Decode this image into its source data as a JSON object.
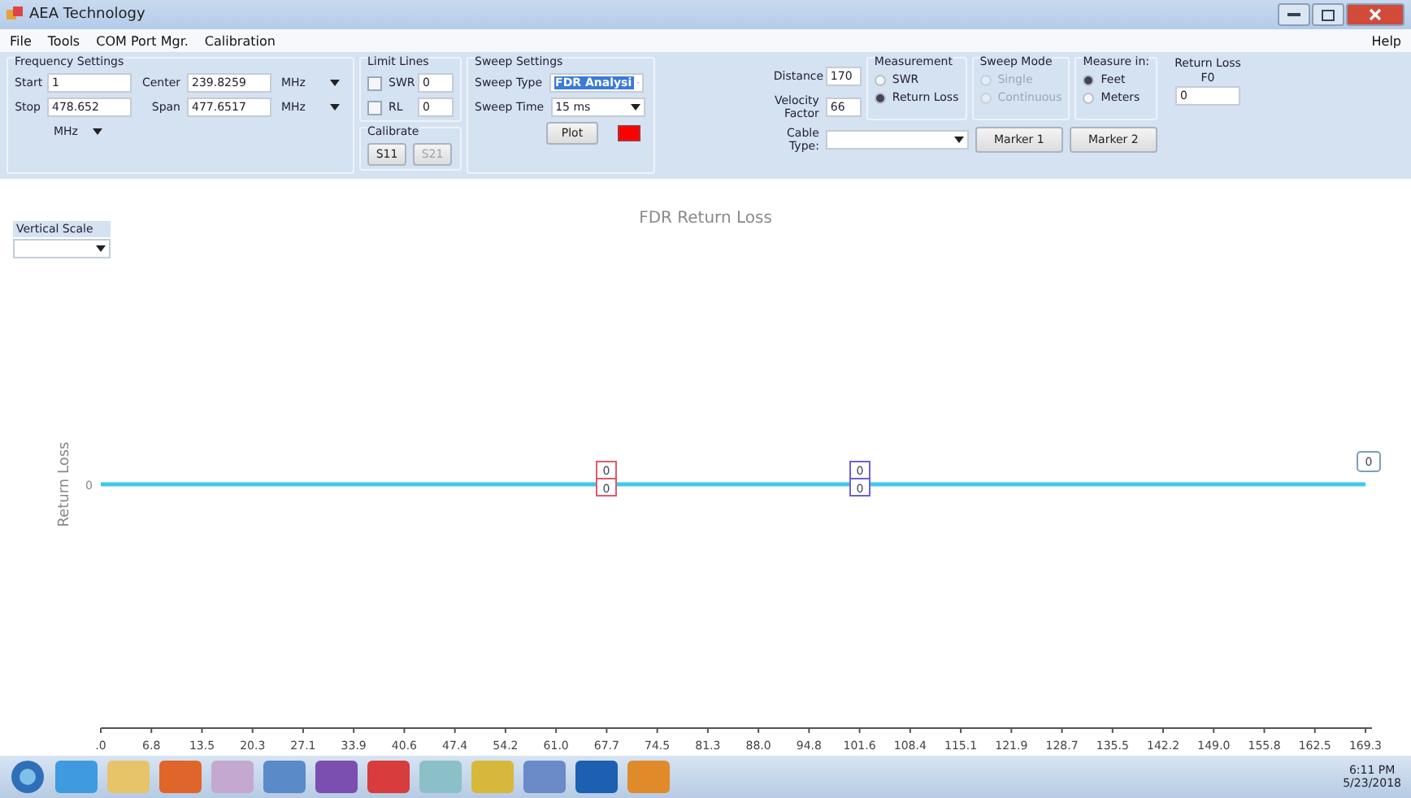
{
  "window": {
    "title": "AEA Technology"
  },
  "menu": [
    {
      "label": "File"
    },
    {
      "label": "Tools"
    },
    {
      "label": "COM Port Mgr."
    },
    {
      "label": "Calibration"
    }
  ],
  "help_menu": {
    "label": "Help"
  },
  "frequency_settings": {
    "title": "Frequency Settings",
    "start": {
      "label": "Start",
      "value": "1"
    },
    "stop": {
      "label": "Stop",
      "value": "478.652"
    },
    "center": {
      "label": "Center",
      "value": "239.8259",
      "unit": "MHz"
    },
    "span": {
      "label": "Span",
      "value": "477.6517",
      "unit": "MHz"
    },
    "unit": "MHz"
  },
  "limit_lines": {
    "title": "Limit Lines",
    "items": [
      {
        "label": "SWR",
        "checked": false,
        "value": "0"
      },
      {
        "label": "RL",
        "checked": false,
        "value": "0"
      }
    ]
  },
  "calibrate": {
    "title": "Calibrate",
    "buttons": [
      {
        "label": "S11",
        "disabled": false
      },
      {
        "label": "S21",
        "disabled": true
      }
    ]
  },
  "sweep_settings": {
    "title": "Sweep Settings",
    "sweep_type": {
      "label": "Sweep Type",
      "value": "FDR Analysi"
    },
    "sweep_time": {
      "label": "Sweep Time",
      "value": "15 ms"
    },
    "plot_button": "Plot"
  },
  "distance": {
    "label": "Distance",
    "value": "170"
  },
  "velocity_factor": {
    "label": "Velocity Factor",
    "value": "66"
  },
  "cable_type": {
    "label": "Cable Type:"
  },
  "measurement": {
    "title": "Measurement",
    "disabled": false,
    "options": [
      {
        "label": "SWR",
        "selected": false
      },
      {
        "label": "Return Loss",
        "selected": true
      }
    ]
  },
  "sweep_mode": {
    "title": "Sweep Mode",
    "disabled": true,
    "options": [
      {
        "label": "Single",
        "selected": false
      },
      {
        "label": "Continuous",
        "selected": false
      }
    ]
  },
  "measure_in": {
    "title": "Measure in:",
    "disabled": false,
    "options": [
      {
        "label": "Feet",
        "selected": true
      },
      {
        "label": "Meters",
        "selected": false
      }
    ]
  },
  "return_loss": {
    "label": "Return Loss",
    "sublabel": "F0",
    "value": "0"
  },
  "marker_buttons": [
    {
      "label": "Marker 1"
    },
    {
      "label": "Marker 2"
    }
  ],
  "vertical_scale": {
    "label": "Vertical Scale"
  },
  "chart": {
    "title": "FDR Return Loss",
    "ylabel": "Return Loss",
    "y_tick_label": "0",
    "x_tick_labels": [
      ".0",
      "6.8",
      "13.5",
      "20.3",
      "27.1",
      "33.9",
      "40.6",
      "47.4",
      "54.2",
      "61.0",
      "67.7",
      "74.5",
      "81.3",
      "88.0",
      "94.8",
      "101.6",
      "108.4",
      "115.1",
      "121.9",
      "128.7",
      "135.5",
      "142.2",
      "149.0",
      "155.8",
      "162.5",
      "169.3"
    ],
    "markers": [
      {
        "kind": "marker",
        "color": "#e05a6a",
        "labels": [
          "0",
          "0"
        ]
      },
      {
        "kind": "marker",
        "color": "#7060d0",
        "labels": [
          "0",
          "0"
        ]
      },
      {
        "kind": "callout",
        "color": "#7aa0b8",
        "labels": [
          "0"
        ]
      }
    ]
  },
  "taskbar": {
    "time": "6:11 PM",
    "date": "5/23/2018"
  }
}
